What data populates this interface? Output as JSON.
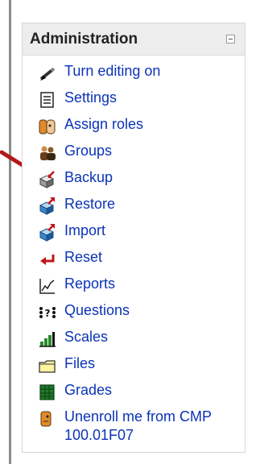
{
  "block": {
    "title": "Administration",
    "items": [
      {
        "label": "Turn editing on",
        "icon": "pencil-icon"
      },
      {
        "label": "Settings",
        "icon": "settings-document-icon"
      },
      {
        "label": "Assign roles",
        "icon": "assign-roles-icon"
      },
      {
        "label": "Groups",
        "icon": "groups-icon"
      },
      {
        "label": "Backup",
        "icon": "backup-icon"
      },
      {
        "label": "Restore",
        "icon": "restore-icon"
      },
      {
        "label": "Import",
        "icon": "import-icon"
      },
      {
        "label": "Reset",
        "icon": "reset-icon"
      },
      {
        "label": "Reports",
        "icon": "reports-icon"
      },
      {
        "label": "Questions",
        "icon": "questions-icon"
      },
      {
        "label": "Scales",
        "icon": "scales-icon"
      },
      {
        "label": "Files",
        "icon": "folder-icon"
      },
      {
        "label": "Grades",
        "icon": "grades-icon"
      },
      {
        "label": "Unenroll me from CMP 100.01F07",
        "icon": "unenroll-icon"
      }
    ]
  },
  "colors": {
    "link": "#0b33b6",
    "pointer_arrow": "#b01a1a"
  }
}
